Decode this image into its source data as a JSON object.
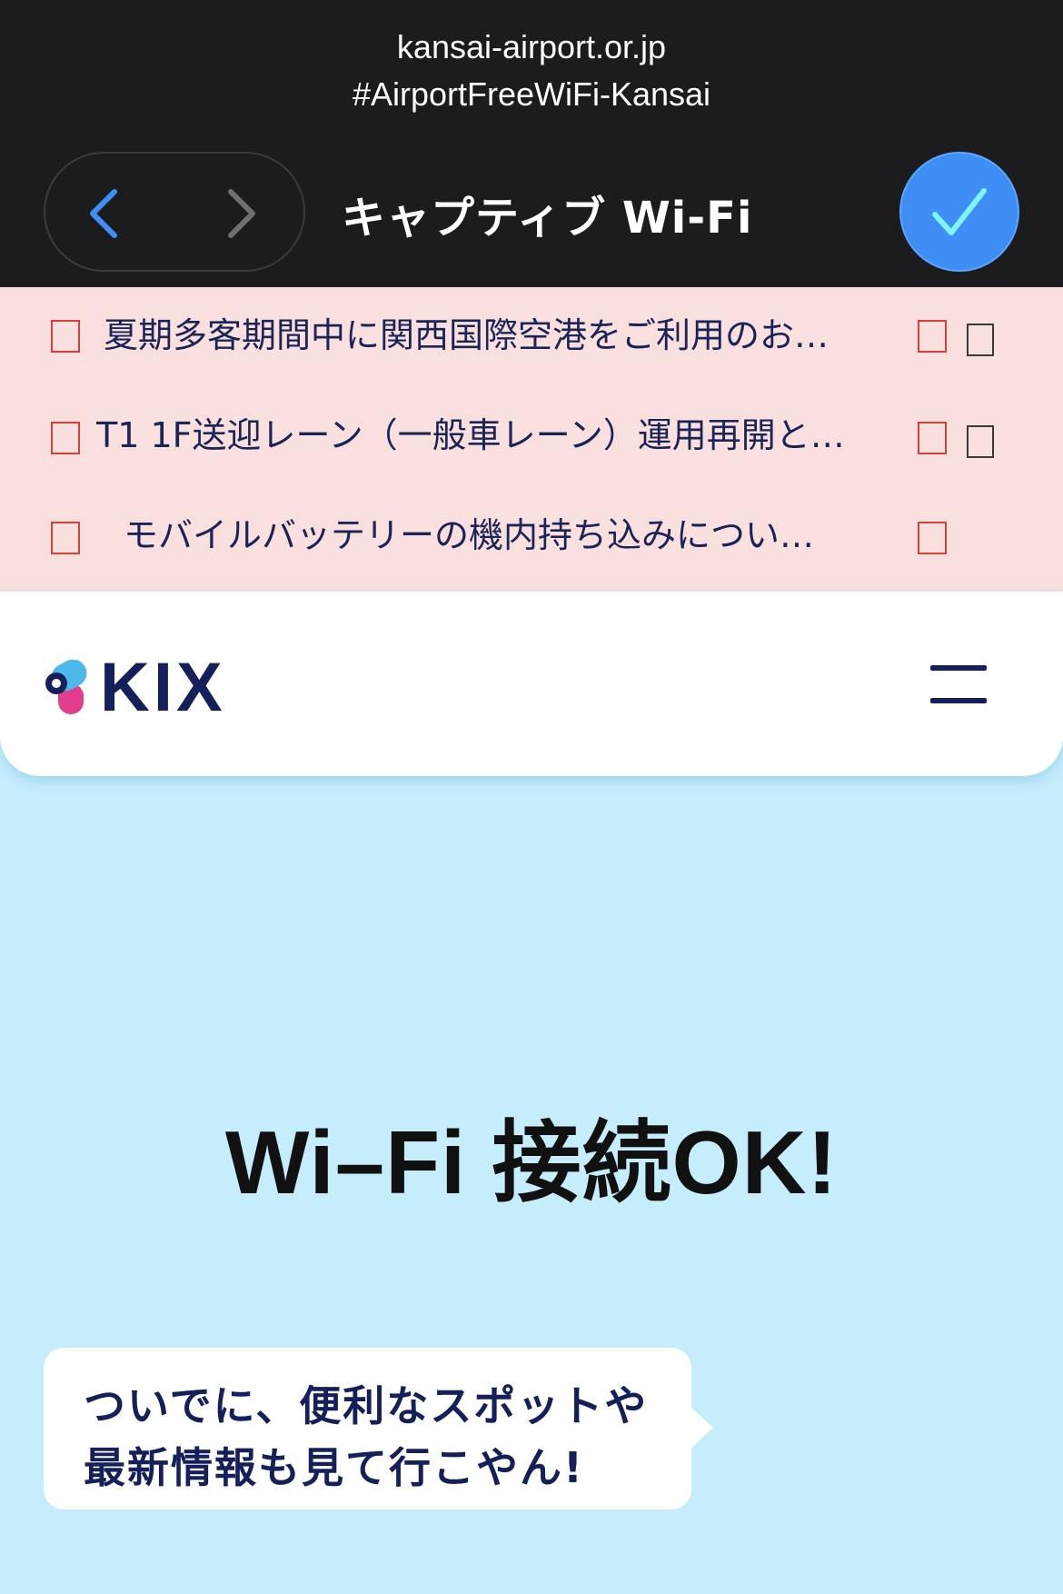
{
  "topbar": {
    "url_line1": "kansai-airport.or.jp",
    "url_line2": "#AirportFreeWiFi-Kansai",
    "title": "キャプティブ Wi-Fi",
    "back_icon": "chevron-left-icon",
    "forward_icon": "chevron-right-icon",
    "done_icon": "checkmark-icon",
    "accent": "#3e8ef6"
  },
  "notices": {
    "items": [
      {
        "text": "夏期多客期間中に関西国際空港をご利用のお…"
      },
      {
        "text": "T1 1F送迎レーン（一般車レーン）運用再開と…"
      },
      {
        "text": "モバイルバッテリーの機内持ち込みについ…"
      }
    ],
    "background": "#f9e0df"
  },
  "header": {
    "logo_text": "KIX",
    "menu_icon": "hamburger-menu-icon",
    "brand_color": "#15205a"
  },
  "hero": {
    "title": "Wi–Fi 接続OK!",
    "bubble_line1": "ついでに、便利なスポットや",
    "bubble_line2": "最新情報も見て行こやん!",
    "background": "#c6edfc"
  }
}
